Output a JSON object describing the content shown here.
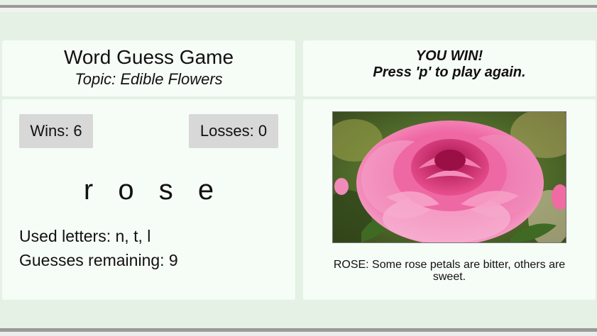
{
  "game": {
    "title": "Word Guess Game",
    "topic": "Topic: Edible Flowers"
  },
  "status": {
    "win_message": "YOU WIN!",
    "replay_message": "Press 'p' to play again."
  },
  "score": {
    "wins_label": "Wins: 6",
    "losses_label": "Losses: 0"
  },
  "puzzle": {
    "word": "r o s e",
    "used_letters": "Used letters: n, t, l",
    "guesses_remaining": "Guesses remaining: 9"
  },
  "reveal": {
    "image_subject": "pink rose flower",
    "caption": "ROSE: Some rose petals are bitter, others are sweet."
  },
  "colors": {
    "page_background": "#e4f1e4",
    "panel_background": "#f6fcf6",
    "score_box": "#d8d8d8",
    "rule": "#9a9a9a",
    "rose_pink": "#f05a9c"
  }
}
